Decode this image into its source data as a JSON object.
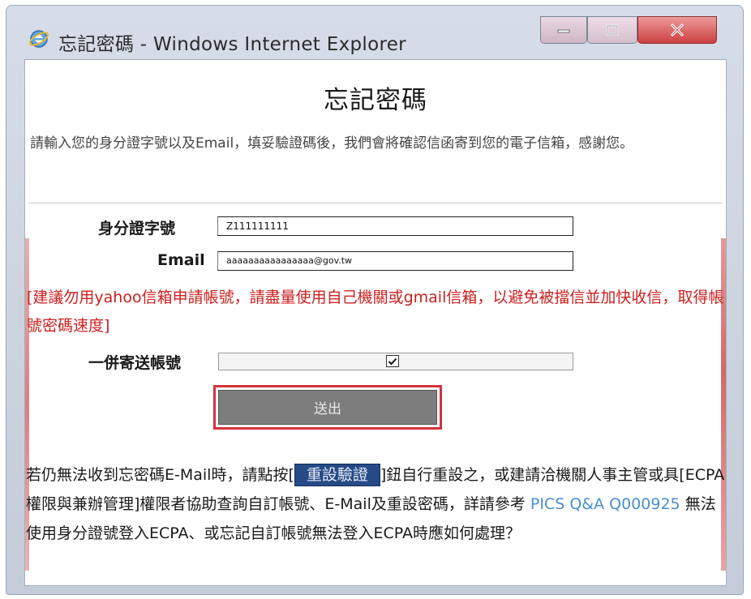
{
  "window": {
    "title": "忘記密碼 - Windows Internet Explorer"
  },
  "page": {
    "heading": "忘記密碼",
    "intro": "請輸入您的身分證字號以及Email，填妥驗證碼後，我們會將確認信函寄到您的電子信箱，感謝您。"
  },
  "form": {
    "id_label": "身分證字號",
    "id_value": "Z111111111",
    "email_label": "Email",
    "email_value": "aaaaaaaaaaaaaaaa@gov.tw",
    "warning": "[建議勿用yahoo信箱申請帳號，請盡量使用自己機關或gmail信箱，以避免被擋信並加快收信，取得帳號密碼速度]",
    "send_account_label": "一併寄送帳號",
    "send_account_checked": true,
    "submit_label": "送出"
  },
  "footer": {
    "part1": "若仍無法收到忘密碼E-Mail時，請點按[",
    "reset_button": "重設驗證",
    "part2": "]鈕自行重設之，或建請洽機關人事主管或具[ECPA權限與兼辦管理]權限者協助查詢自訂帳號、E-Mail及重設密碼，詳請參考 ",
    "link_text": "PICS Q&A Q000925",
    "part3": " 無法使用身分證號登入ECPA、或忘記自訂帳號無法登入ECPA時應如何處理？"
  },
  "colors": {
    "warning_text": "#cc2020",
    "reset_button_bg": "#254a86",
    "link": "#4a8fd0",
    "close_button": "#cc4040",
    "submit_border": "#d4333d"
  },
  "icons": {
    "app": "internet-explorer-icon",
    "minimize": "minimize-icon",
    "maximize": "maximize-icon",
    "close": "close-icon",
    "check": "check-icon"
  }
}
